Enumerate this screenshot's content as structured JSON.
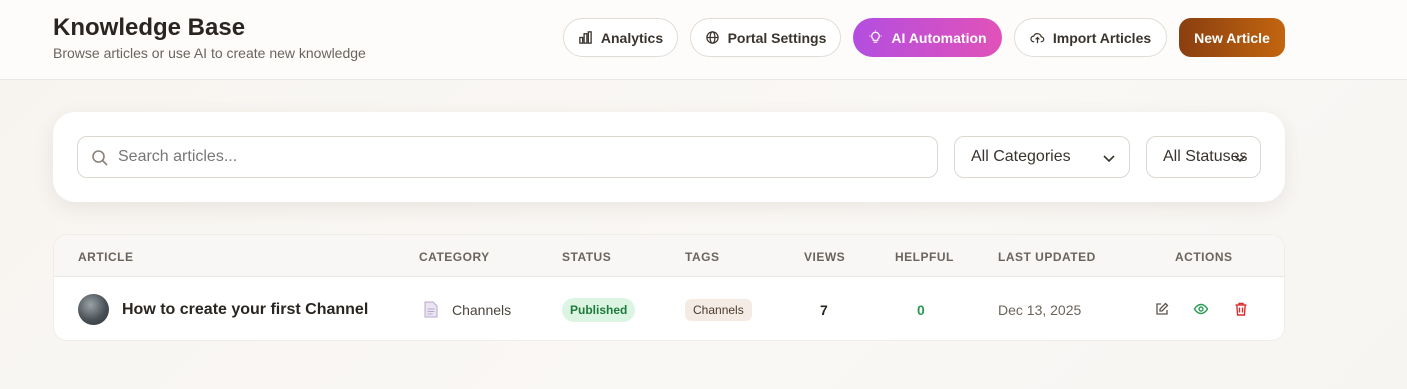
{
  "header": {
    "title": "Knowledge Base",
    "subtitle": "Browse articles or use AI to create new knowledge",
    "buttons": {
      "analytics": "Analytics",
      "portal_settings": "Portal Settings",
      "ai_automation": "AI Automation",
      "import_articles": "Import Articles",
      "new_article": "New Article"
    }
  },
  "filters": {
    "search_placeholder": "Search articles...",
    "category_value": "All Categories",
    "status_value": "All Statuses"
  },
  "table": {
    "columns": [
      "ARTICLE",
      "CATEGORY",
      "STATUS",
      "TAGS",
      "VIEWS",
      "HELPFUL",
      "LAST UPDATED",
      "ACTIONS"
    ],
    "rows": [
      {
        "title": "How to create your first Channel",
        "category": "Channels",
        "status": "Published",
        "tag": "Channels",
        "views": "7",
        "helpful": "0",
        "updated": "Dec 13, 2025"
      }
    ]
  },
  "colors": {
    "ai_gradient": [
      "#b34ee0",
      "#e152b8"
    ],
    "new_gradient": [
      "#8a3f10",
      "#c2650f"
    ],
    "published": "#1f7a3c",
    "helpful": "#2a9a52",
    "delete": "#d92d2d"
  },
  "icons": [
    "bar-chart-icon",
    "globe-icon",
    "lightbulb-icon",
    "upload-cloud-icon",
    "search-icon",
    "chevron-down-icon",
    "document-icon",
    "edit-icon",
    "eye-icon",
    "trash-icon"
  ]
}
